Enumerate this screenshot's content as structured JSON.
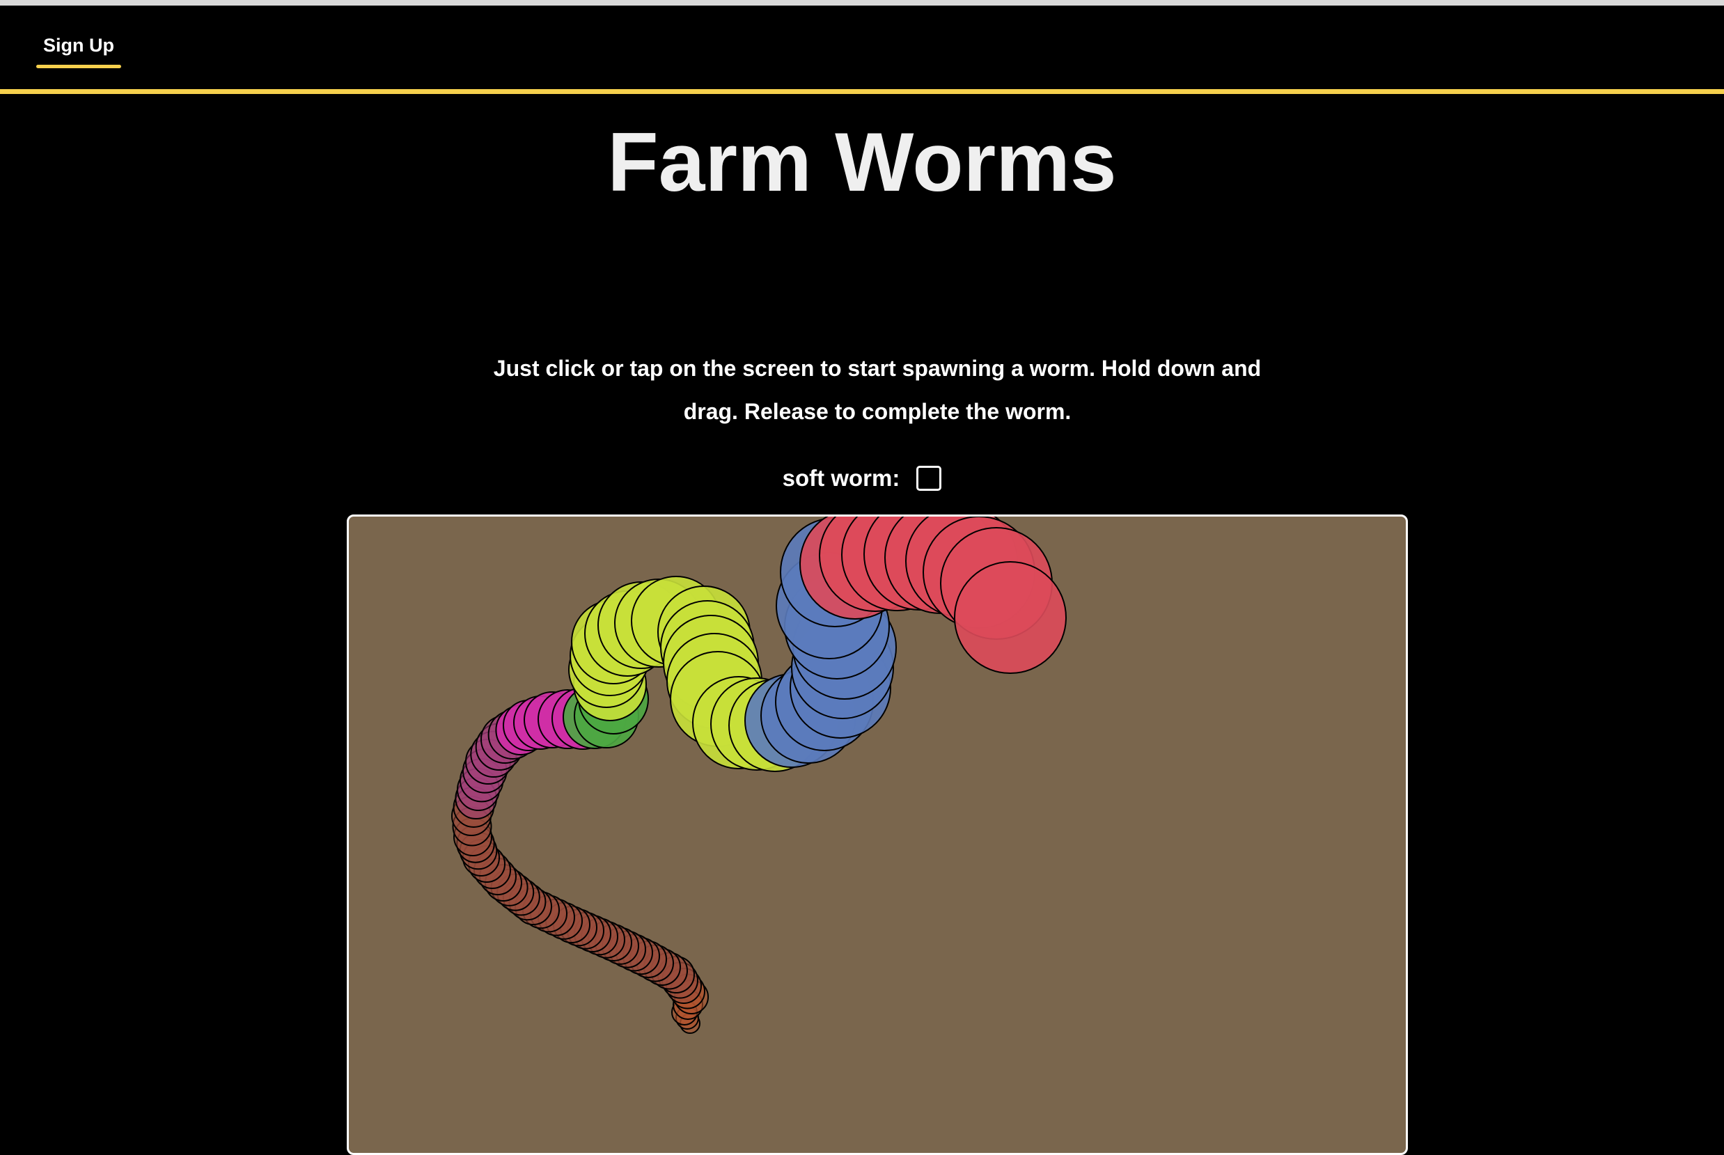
{
  "nav": {
    "signup_label": "Sign Up",
    "accent_color": "#f6d04d"
  },
  "page": {
    "title": "Farm Worms",
    "instructions": "Just click or tap on the screen to start spawning a worm. Hold down and drag. Release to complete the worm."
  },
  "options": {
    "soft_worm_label": "soft worm:",
    "soft_worm_checked": false
  },
  "canvas": {
    "background_color": "#7a664d",
    "worm_segment_colors": {
      "tail": "#b5532e",
      "body_brown": "#9a4c3d",
      "purple": "#a43f7c",
      "magenta": "#cf2fa6",
      "green": "#4ca842",
      "yellow_green": "#c8e03a",
      "blue": "#5b7bbd",
      "red": "#dd4a5a"
    }
  }
}
